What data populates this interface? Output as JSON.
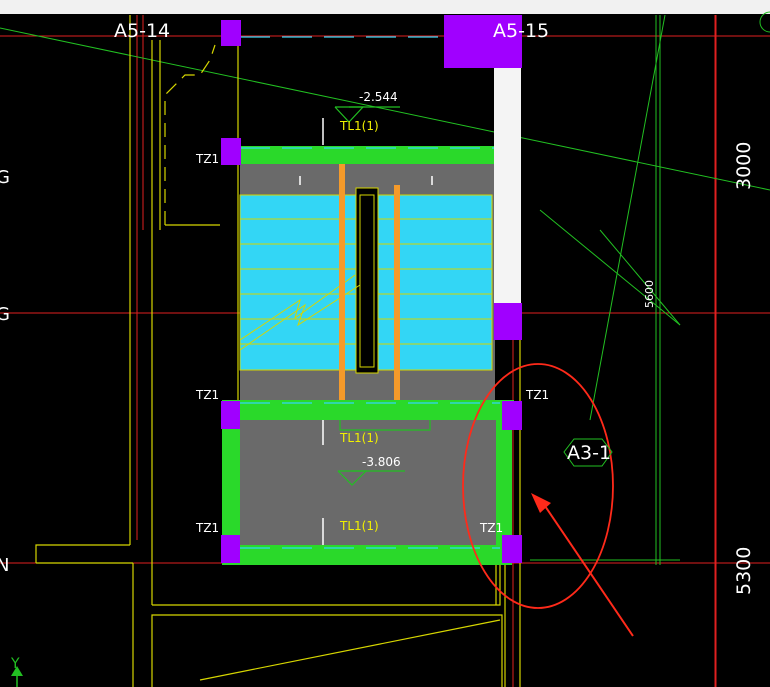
{
  "viewport": {
    "background": "#000000"
  },
  "grid_labels": {
    "a5_14": "A5-14",
    "a5_15": "A5-15",
    "a3_1": "A3-1",
    "row_g_top": "G",
    "row_g_mid": "G",
    "row_n": "N"
  },
  "dimensions": {
    "d3000": "3000",
    "d5300": "5300",
    "d5600": "5600"
  },
  "elevations": {
    "top": "-2.544",
    "bottom": "-3.806"
  },
  "column_tags": {
    "tz1_a": "TZ1",
    "tz1_b": "TZ1",
    "tz1_c": "TZ1",
    "tz1_d": "TZ1",
    "tz1_e": "TZ1"
  },
  "beam_tags": {
    "tl1_a": "TL1(1)",
    "tl1_b": "TL1(1)",
    "tl1_c": "TL1(1)"
  },
  "axis": {
    "y_label": "Y"
  },
  "colors": {
    "grid_red": "#e02020",
    "grid_green": "#22c022",
    "wall_yellow": "#d6d600",
    "beam_green": "#2ad92a",
    "column_magenta": "#a000ff",
    "stair_cyan": "#33d6f5",
    "handrail_orange": "#f59a2a",
    "slab_gray": "#6a6a6a",
    "annotation_red": "#ff2a1a"
  }
}
